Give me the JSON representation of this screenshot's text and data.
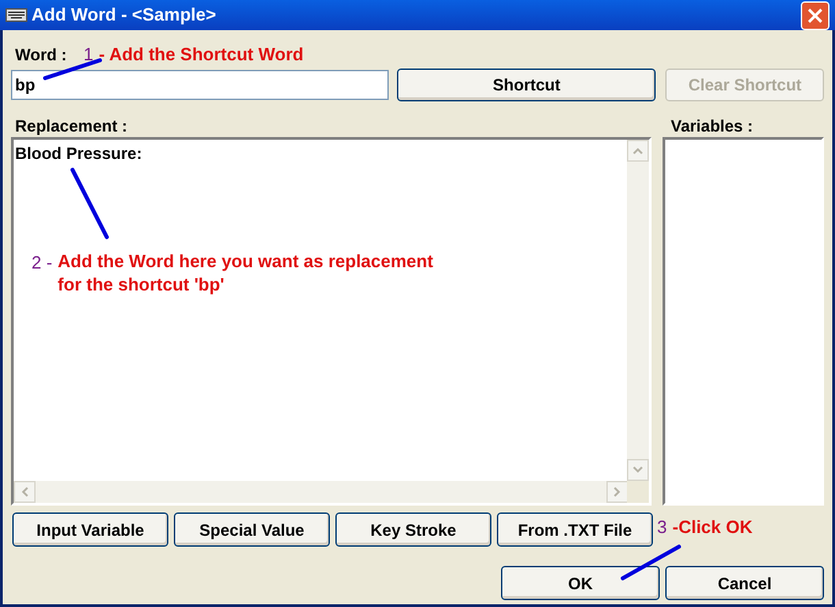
{
  "window": {
    "title": "Add Word - <Sample>"
  },
  "word": {
    "label": "Word :",
    "value": "bp"
  },
  "top_buttons": [
    {
      "label": "Shortcut",
      "disabled": false
    },
    {
      "label": "Clear Shortcut",
      "disabled": true
    }
  ],
  "replacement": {
    "label": "Replacement :",
    "value": "Blood Pressure:"
  },
  "variables": {
    "label": "Variables :"
  },
  "insert_buttons": [
    "Input Variable",
    "Special Value",
    "Key Stroke",
    "From .TXT File"
  ],
  "dialog_buttons": [
    "OK",
    "Cancel"
  ],
  "annotations": [
    {
      "number": "1",
      "text": "- Add the Shortcut Word"
    },
    {
      "number": "2 -",
      "text": "Add the Word here you want as replacement for the shortcut 'bp'"
    },
    {
      "number": "3",
      "text": "-Click OK"
    }
  ]
}
